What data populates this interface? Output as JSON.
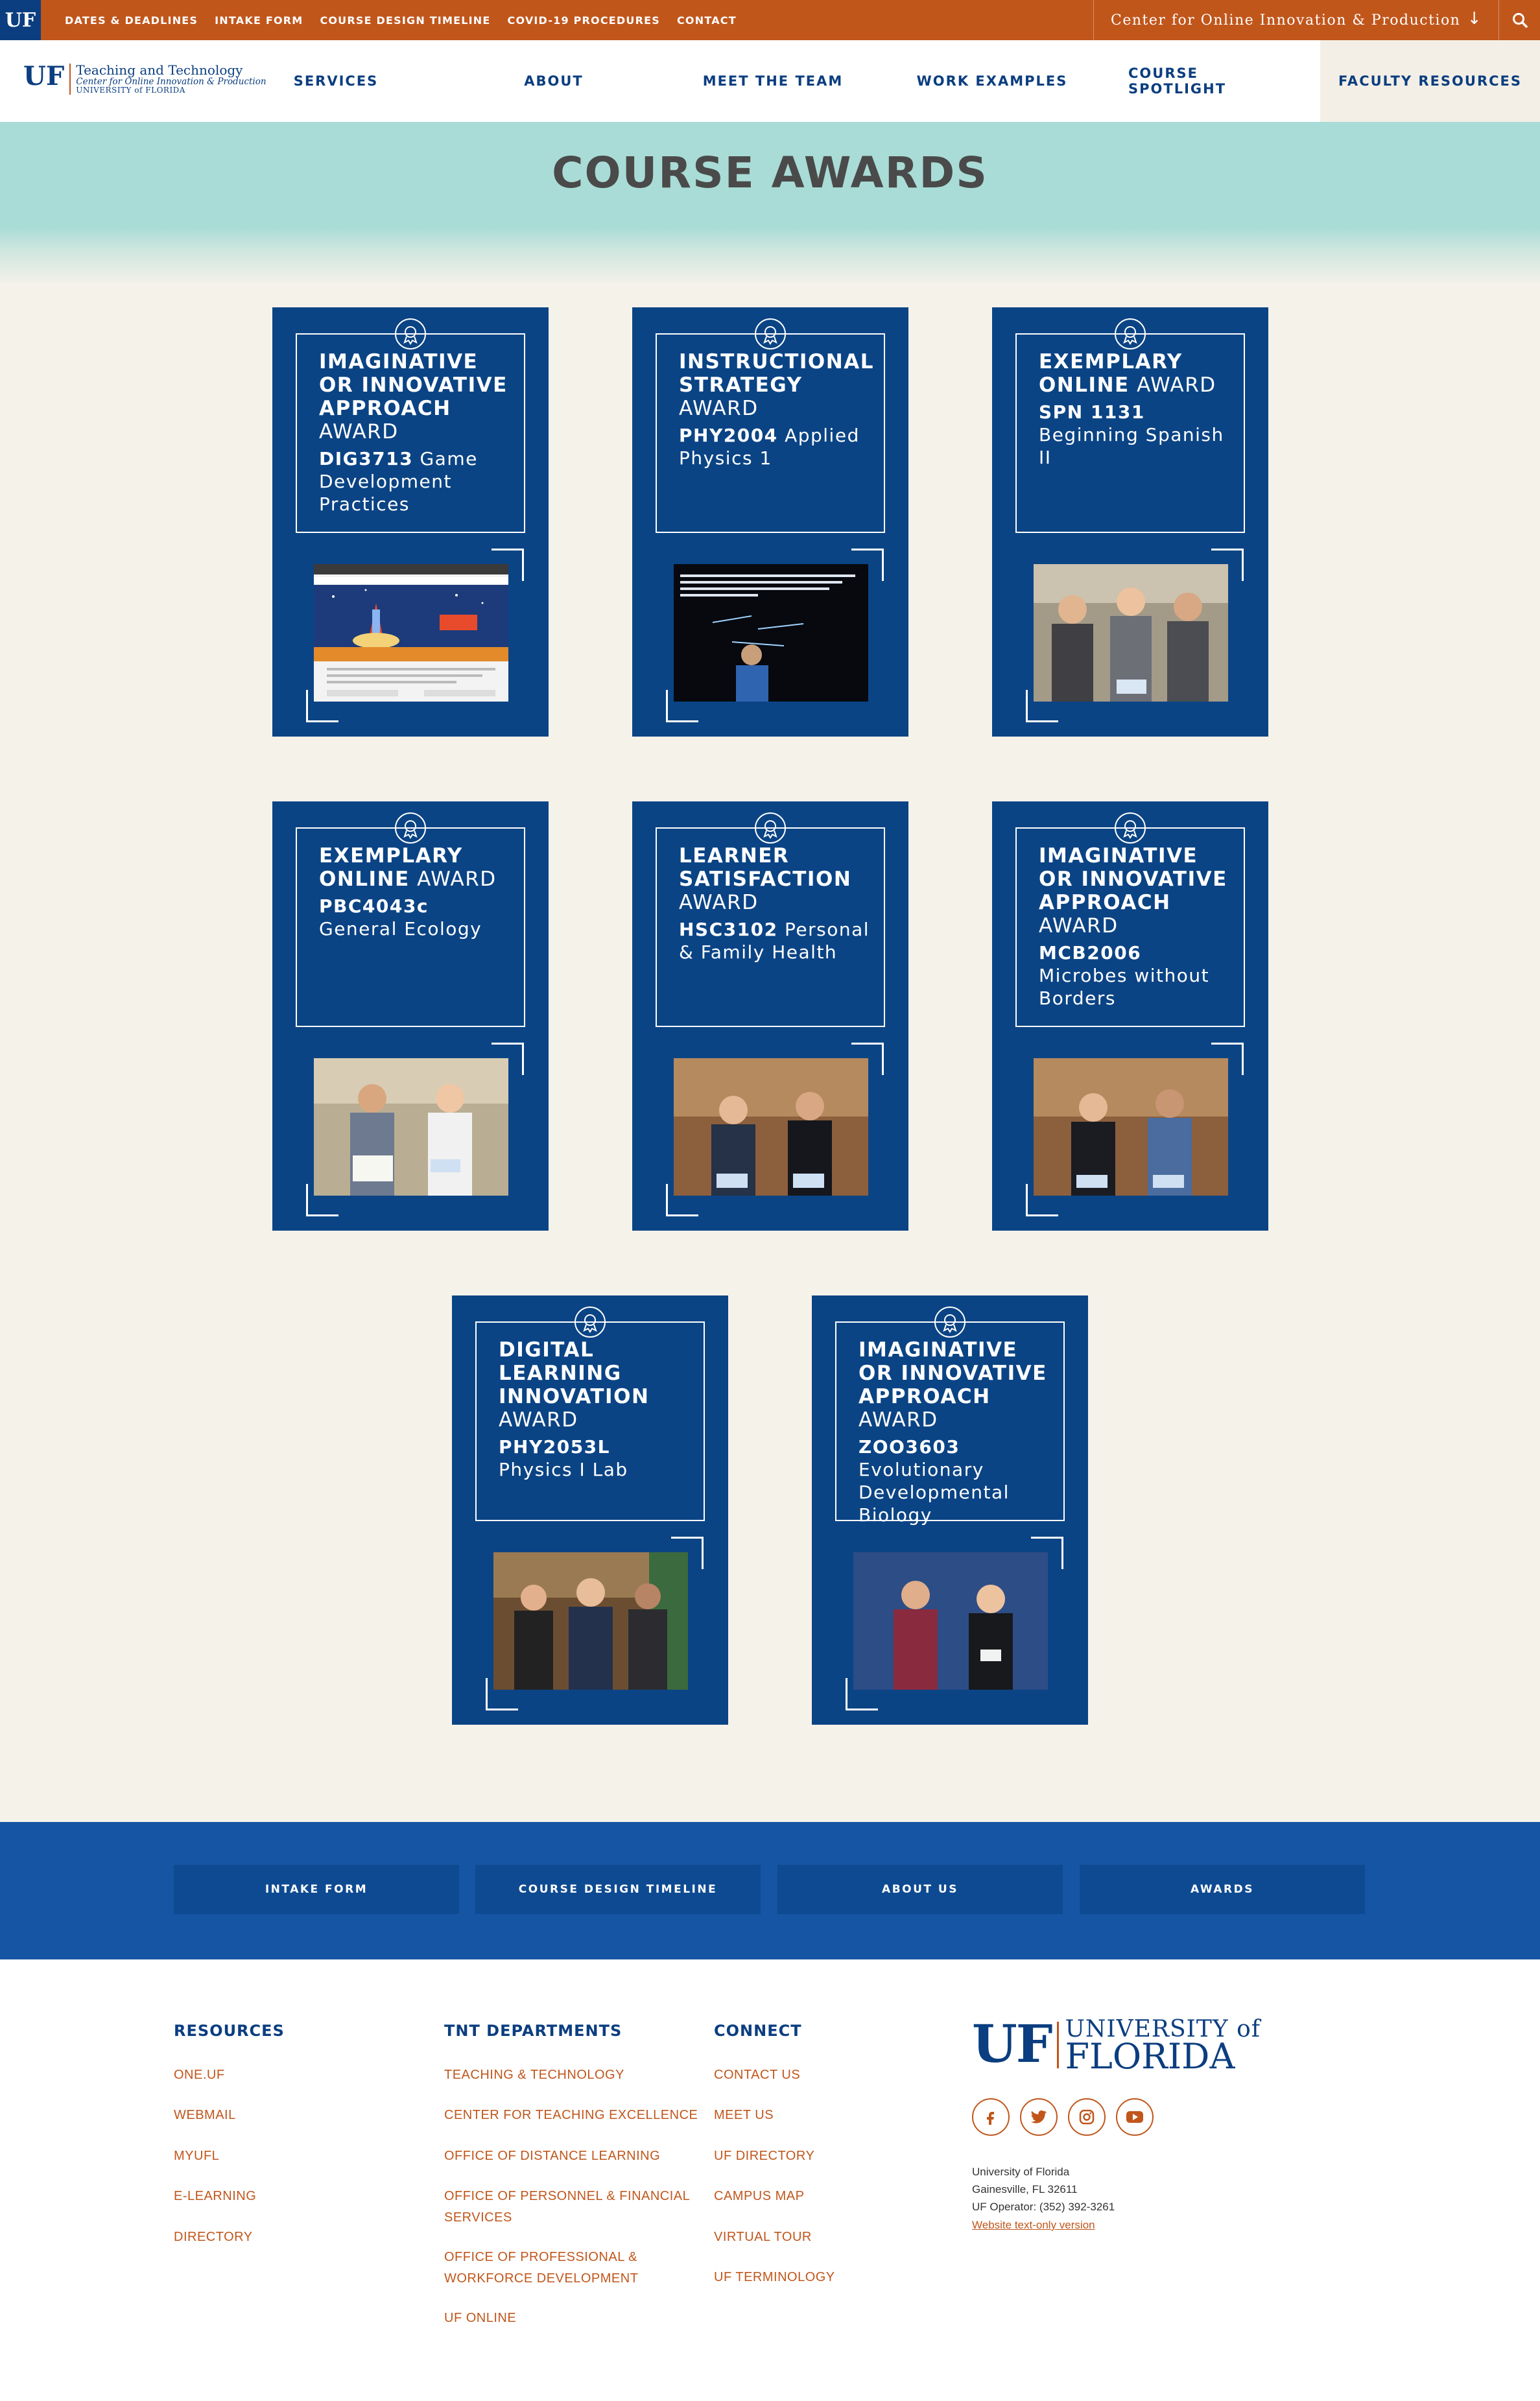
{
  "topbar": {
    "uf_label": "UF",
    "links": [
      "DATES & DEADLINES",
      "INTAKE FORM",
      "COURSE DESIGN TIMELINE",
      "COVID-19 PROCEDURES",
      "CONTACT"
    ],
    "center_select": "Center for Online Innovation & Production",
    "bg_color": "#c1561b"
  },
  "logo": {
    "uf": "UF",
    "line1": "Teaching and Technology",
    "line2": "Center for Online Innovation & Production",
    "line3": "UNIVERSITY of FLORIDA"
  },
  "nav": {
    "items": [
      "SERVICES",
      "ABOUT",
      "MEET THE TEAM",
      "WORK EXAMPLES",
      "COURSE SPOTLIGHT",
      "FACULTY RESOURCES"
    ],
    "active": "FACULTY RESOURCES"
  },
  "page": {
    "title": "COURSE AWARDS"
  },
  "awards": [
    {
      "title_bold": "IMAGINATIVE OR INNOVATIVE APPROACH",
      "title_rest": "AWARD",
      "course_code": "DIG3713",
      "course_name": "Game Development Practices",
      "image": "game-screenshot"
    },
    {
      "title_bold": "INSTRUCTIONAL STRATEGY",
      "title_rest": "AWARD",
      "course_code": "PHY2004",
      "course_name": "Applied Physics 1",
      "image": "lightboard-lecture"
    },
    {
      "title_bold": "EXEMPLARY ONLINE",
      "title_rest": "AWARD",
      "course_code": "SPN 1131",
      "course_name": "Beginning Spanish II",
      "image": "award-photo-three-people"
    },
    {
      "title_bold": "EXEMPLARY ONLINE",
      "title_rest": "AWARD",
      "course_code": "PBC4043c",
      "course_name": "General Ecology",
      "image": "award-photo-two-people"
    },
    {
      "title_bold": "LEARNER SATISFACTION",
      "title_rest": "AWARD",
      "course_code": "HSC3102",
      "course_name": "Personal & Family Health",
      "image": "award-photo-two-women"
    },
    {
      "title_bold": "IMAGINATIVE OR INNOVATIVE APPROACH",
      "title_rest": "AWARD",
      "course_code": "MCB2006",
      "course_name": "Microbes without Borders",
      "image": "award-photo-two-people"
    },
    {
      "title_bold": "DIGITAL LEARNING INNOVATION",
      "title_rest": "AWARD",
      "course_code": "PHY2053L",
      "course_name": "Physics I Lab",
      "image": "award-photo-three-people"
    },
    {
      "title_bold": "IMAGINATIVE OR INNOVATIVE APPROACH",
      "title_rest": "AWARD",
      "course_code": "ZOO3603",
      "course_name": "Evolutionary Developmental Biology",
      "image": "award-photo-two-people"
    }
  ],
  "quicklinks": [
    "INTAKE FORM",
    "COURSE DESIGN TIMELINE",
    "ABOUT US",
    "AWARDS"
  ],
  "footer": {
    "resources": {
      "title": "RESOURCES",
      "links": [
        "ONE.UF",
        "WEBMAIL",
        "MYUFL",
        "E-LEARNING",
        "DIRECTORY"
      ]
    },
    "departments": {
      "title": "TNT DEPARTMENTS",
      "links": [
        [
          "TEACHING & TECHNOLOGY"
        ],
        [
          "CENTER FOR TEACHING EXCELLENCE"
        ],
        [
          "OFFICE OF DISTANCE LEARNING"
        ],
        [
          "OFFICE OF PERSONNEL & FINANCIAL",
          "SERVICES"
        ],
        [
          "OFFICE OF PROFESSIONAL &",
          "WORKFORCE DEVELOPMENT"
        ],
        [
          "UF ONLINE"
        ]
      ]
    },
    "connect": {
      "title": "CONNECT",
      "links": [
        "CONTACT US",
        "MEET US",
        "UF DIRECTORY",
        "CAMPUS MAP",
        "VIRTUAL TOUR",
        "UF TERMINOLOGY"
      ]
    },
    "uf_logo": {
      "uf": "UF",
      "line1": "UNIVERSITY of",
      "line2": "FLORIDA"
    },
    "social": [
      "facebook-icon",
      "twitter-icon",
      "instagram-icon",
      "youtube-icon"
    ],
    "address": [
      "University of Florida",
      "Gainesville, FL 32611",
      "UF Operator: (352) 392-3261"
    ],
    "text_only_link": "Website text-only version"
  },
  "colors": {
    "uf_blue": "#0b3e80",
    "card_blue": "#0b4485",
    "uf_orange": "#c1561b",
    "hero_teal": "#a9dcd6",
    "quicklinks_blue": "#1555a3"
  }
}
